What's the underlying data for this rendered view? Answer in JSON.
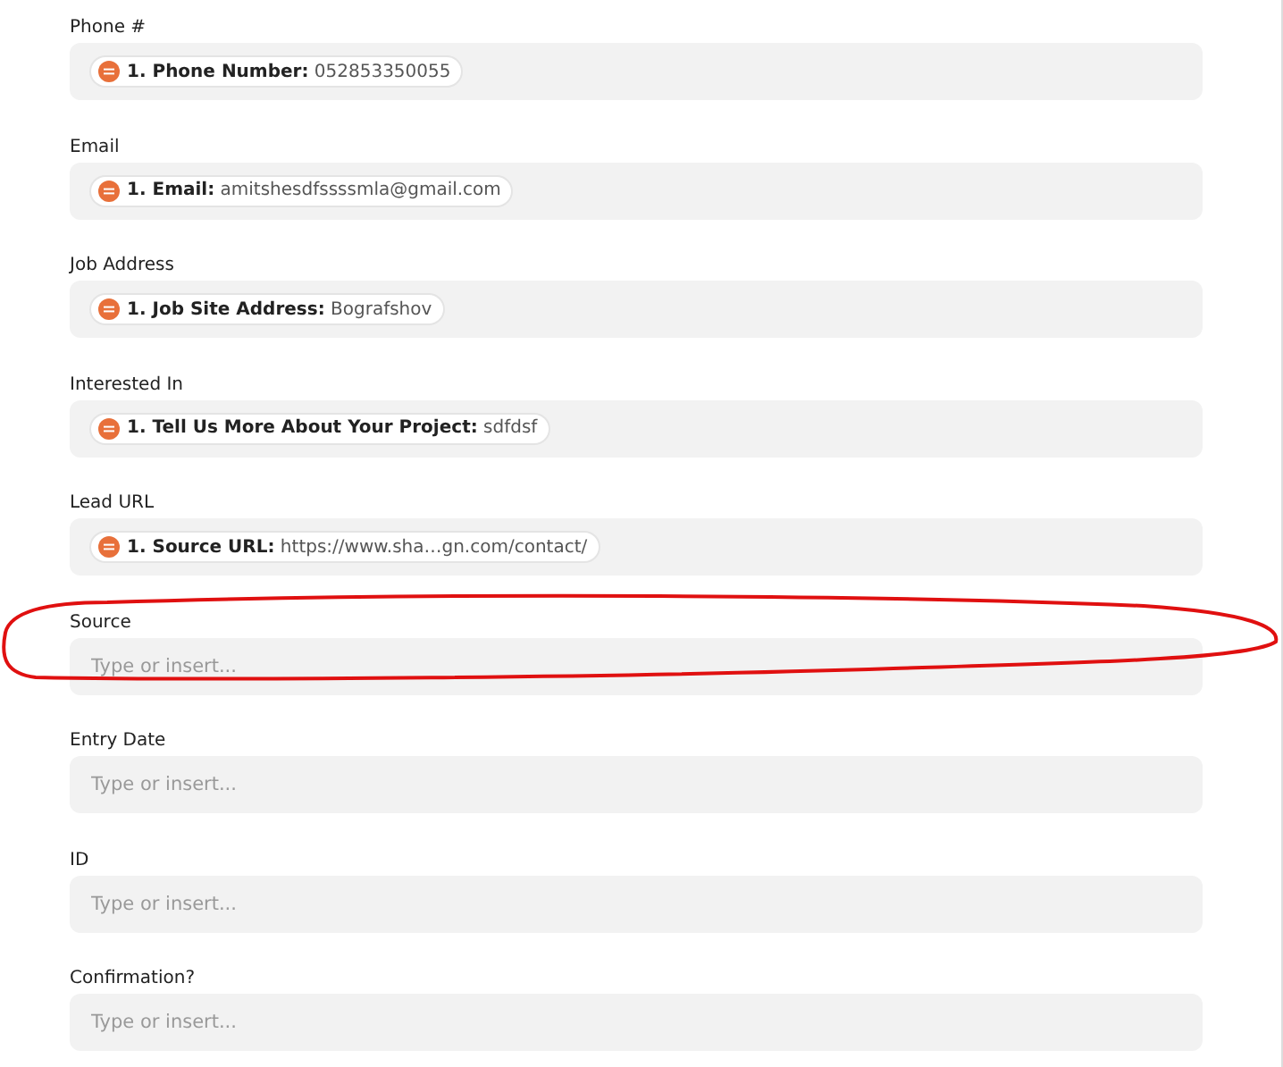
{
  "fields": [
    {
      "label": "Phone #",
      "kind": "token",
      "token": {
        "name": "1. Phone Number:",
        "value": "052853350055"
      },
      "annotated": false
    },
    {
      "label": "Email",
      "kind": "token",
      "token": {
        "name": "1. Email:",
        "value": "amitshesdfssssmla@gmail.com"
      },
      "annotated": false
    },
    {
      "label": "Job Address",
      "kind": "token",
      "token": {
        "name": "1. Job Site Address:",
        "value": "Bografshov"
      },
      "annotated": false
    },
    {
      "label": "Interested In",
      "kind": "token",
      "token": {
        "name": "1. Tell Us More About Your Project:",
        "value": "sdfdsf"
      },
      "annotated": false
    },
    {
      "label": "Lead URL",
      "kind": "token",
      "token": {
        "name": "1. Source URL:",
        "value": "https://www.sha…gn.com/contact/"
      },
      "annotated": false
    },
    {
      "label": "Source",
      "kind": "empty",
      "placeholder": "Type or insert...",
      "annotated": true
    },
    {
      "label": "Entry Date",
      "kind": "empty",
      "placeholder": "Type or insert...",
      "annotated": false
    },
    {
      "label": "ID",
      "kind": "empty",
      "placeholder": "Type or insert...",
      "annotated": false
    },
    {
      "label": "Confirmation?",
      "kind": "empty",
      "placeholder": "Type or insert...",
      "annotated": false
    }
  ]
}
